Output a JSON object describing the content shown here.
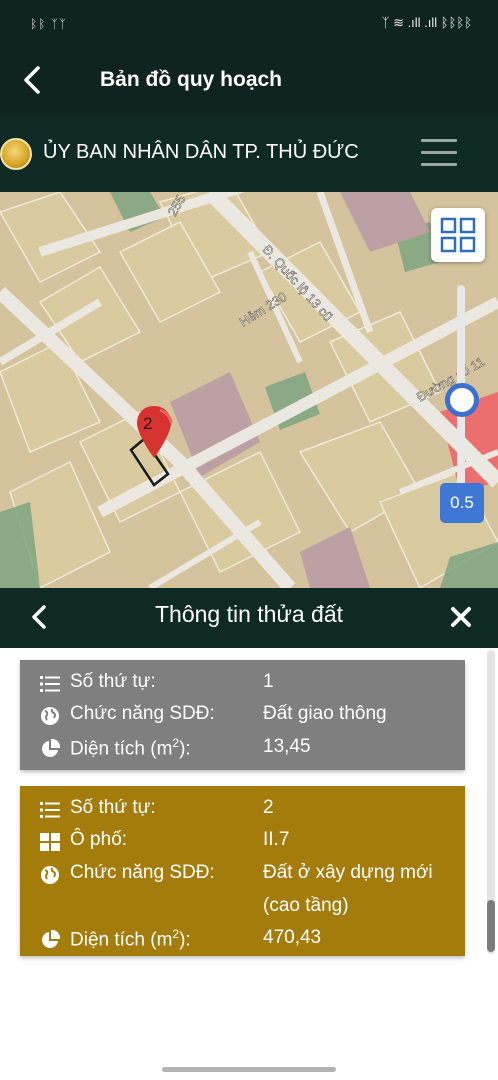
{
  "status_bar": {
    "left_text": "ᛒᛒ ᛉᛉ",
    "right_text": "ᛉ ≋ .ıll .ıll ᛒᛒᛒᛒ"
  },
  "app_bar": {
    "back_icon": "chevron-left-icon",
    "title": "Bản đồ quy hoạch"
  },
  "org_bar": {
    "logo": "emblem-logo",
    "title": "ỦY BAN NHÂN DÂN TP. THỦ ĐỨC",
    "menu_icon": "hamburger-menu-icon"
  },
  "map": {
    "street_labels": [
      "255",
      "Đ. Quốc lộ 13 cũ",
      "Hẻm 230",
      "Đường số 11"
    ],
    "marker_label": "2",
    "layers_icon": "grid-layers-icon",
    "opacity_value": "0.5",
    "opacity_level": 0.5,
    "colors": {
      "residential": "#d4c39c",
      "road": "#ebe8e1",
      "green": "#7fa483",
      "public": "#bda0a4",
      "marker": "#d6322f"
    }
  },
  "panel": {
    "title": "Thông tin thửa đất",
    "back_icon": "chevron-left-icon",
    "close_icon": "close-icon"
  },
  "parcels": [
    {
      "color": "#7f7f7f",
      "stt_label": "Số thứ tự:",
      "stt_value": "1",
      "func_label": "Chức năng SDĐ:",
      "func_value": "Đất giao thông",
      "area_label": "Diện tích (m",
      "area_sup": "2",
      "area_suffix": "):",
      "area_value": "13,45"
    },
    {
      "color": "#a47c0b",
      "stt_label": "Số thứ tự:",
      "stt_value": "2",
      "block_label": "Ô phố:",
      "block_value": "II.7",
      "func_label": "Chức năng SDĐ:",
      "func_value": "Đất ở xây dựng mới",
      "func_value_2": "(cao tầng)",
      "area_label": "Diện tích (m",
      "area_sup": "2",
      "area_suffix": "):",
      "area_value": "470,43"
    }
  ]
}
